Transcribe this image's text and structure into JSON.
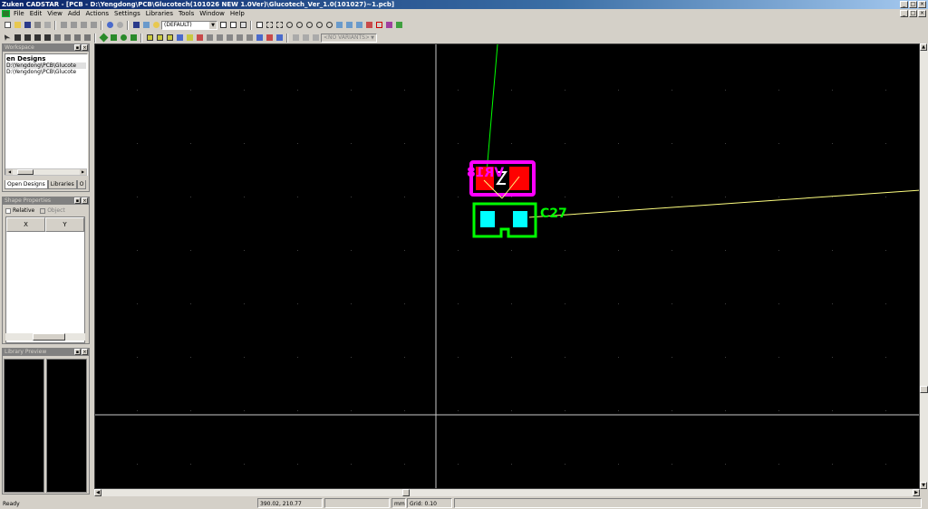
{
  "window": {
    "title": "Zuken CADSTAR - [PCB - D:\\Yengdong\\PCB\\Glucotech(101026 NEW 1.0Ver)\\Glucotech_Ver_1.0(101027)~1.pcb]",
    "minimize": "_",
    "maximize": "□",
    "close": "×"
  },
  "menu": [
    "File",
    "Edit",
    "View",
    "Add",
    "Actions",
    "Settings",
    "Libraries",
    "Tools",
    "Window",
    "Help"
  ],
  "toolbar": {
    "layer_combo": "(DEFAULT)",
    "variant_combo": "<NO VARIANTS>"
  },
  "workspace": {
    "title": "Workspace",
    "heading": "en Designs",
    "items": [
      "D:\\Yengdong\\PCB\\Glucote",
      "D:\\Yengdong\\PCB\\Glucote"
    ],
    "tabs": [
      "Open Designs",
      "Libraries",
      "O"
    ]
  },
  "shape_properties": {
    "title": "Shape Properties",
    "relative_label": "Relative",
    "object_label": "Object",
    "columns": [
      "X",
      "Y"
    ]
  },
  "library_preview": {
    "title": "Library Preview"
  },
  "canvas": {
    "component_labels": [
      {
        "ref": "VR18",
        "color": "#ff00ff"
      },
      {
        "ref": "C27",
        "color": "#00ff00"
      }
    ],
    "colors": {
      "background": "#000000",
      "grid_dot": "#404040",
      "crosshair": "#c8c8c8",
      "ratsnest_green": "#00ff00",
      "ratsnest_yellow": "#ffff80",
      "vr_outline": "#ff00ff",
      "vr_pad": "#ff0000",
      "c_outline": "#00ff00",
      "c_pad": "#00ffff"
    }
  },
  "status": {
    "left": "Ready",
    "coords": "390.02, 210.77",
    "units": "mm",
    "grid": "Grid: 0.10"
  }
}
